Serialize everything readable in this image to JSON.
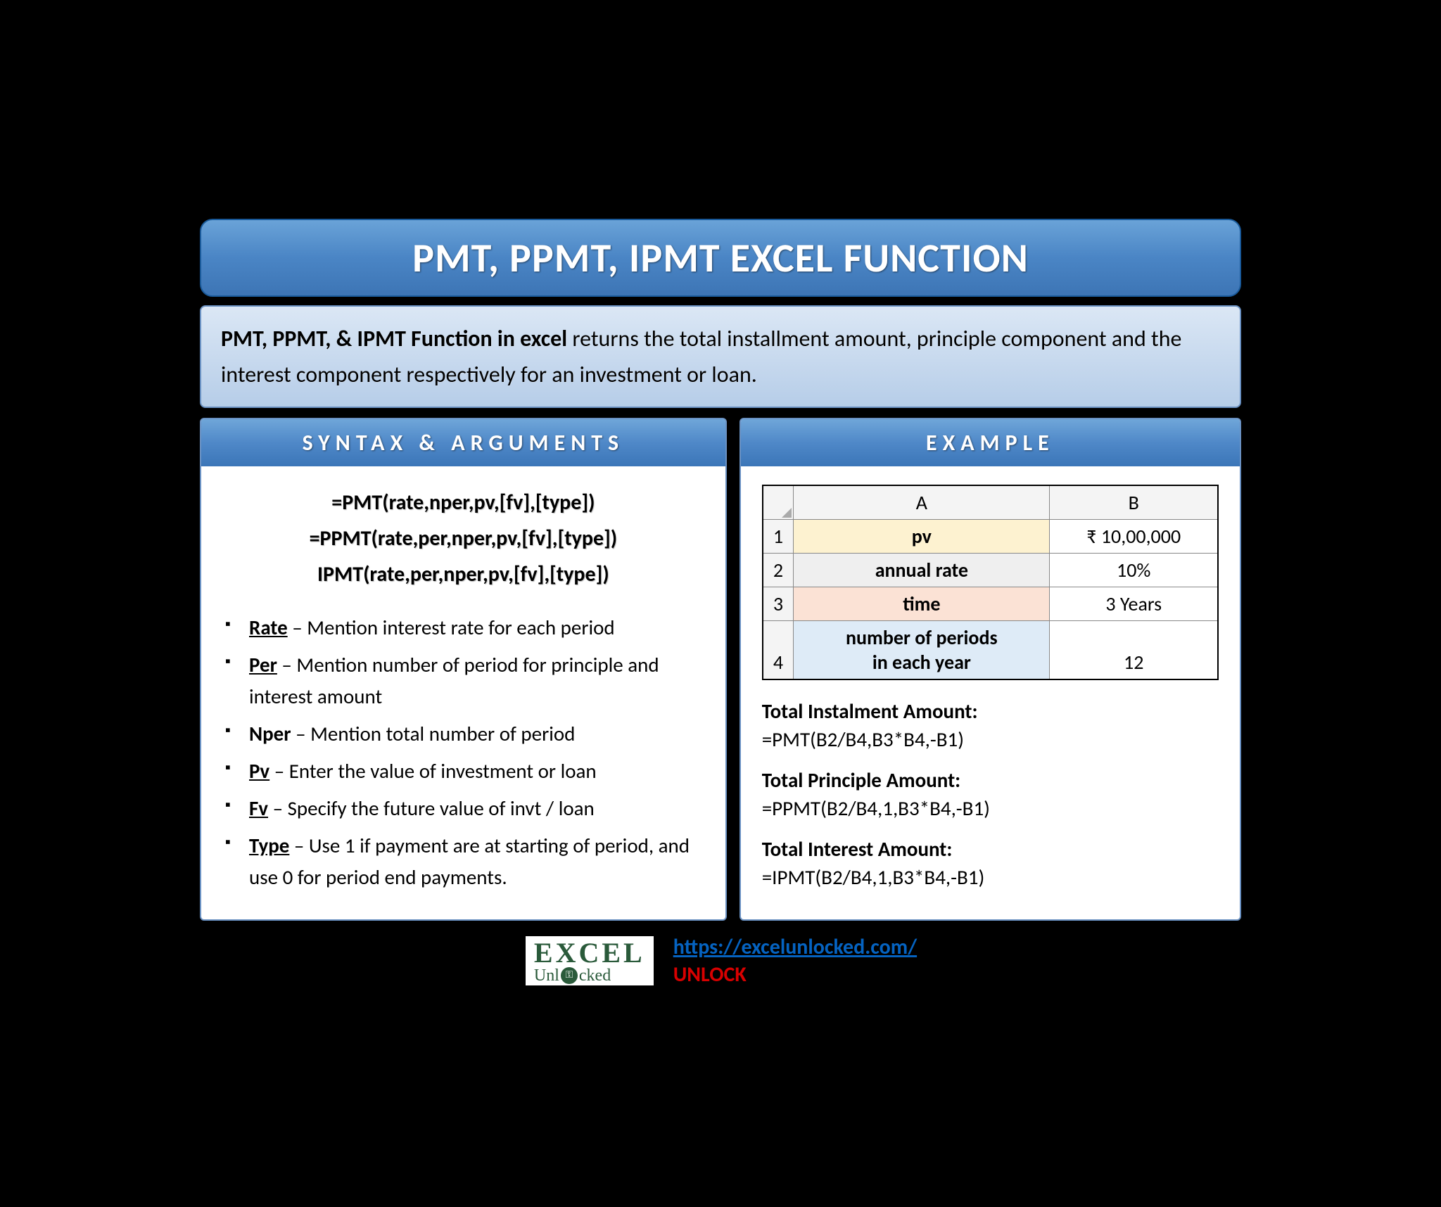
{
  "title": "PMT, PPMT, IPMT EXCEL FUNCTION",
  "description": {
    "bold": "PMT, PPMT, & IPMT Function in excel",
    "rest": " returns the total installment amount, principle component and the interest component respectively for an investment or loan."
  },
  "syntax": {
    "header": "SYNTAX & ARGUMENTS",
    "lines": [
      "=PMT(rate,nper,pv,[fv],[type])",
      "=PPMT(rate,per,nper,pv,[fv],[type])",
      "IPMT(rate,per,nper,pv,[fv],[type])"
    ],
    "args": [
      {
        "term": "Rate",
        "underline": true,
        "desc": " – Mention interest rate for each period"
      },
      {
        "term": "Per",
        "underline": true,
        "desc": " – Mention number of period for principle and interest amount"
      },
      {
        "term": "Nper",
        "underline": false,
        "desc": " – Mention total number of period"
      },
      {
        "term": "Pv",
        "underline": true,
        "desc": " – Enter the value of investment or loan"
      },
      {
        "term": "Fv",
        "underline": true,
        "desc": " – Specify the future value of invt / loan"
      },
      {
        "term": "Type",
        "underline": true,
        "desc": " – Use 1 if payment are at starting of period, and use 0 for period end payments."
      }
    ]
  },
  "example": {
    "header": "EXAMPLE",
    "grid": {
      "colA": "A",
      "colB": "B",
      "rows": [
        {
          "n": "1",
          "a": "pv",
          "b": "₹ 10,00,000",
          "cls": "cell-pv"
        },
        {
          "n": "2",
          "a": "annual rate",
          "b": "10%",
          "cls": "cell-rate"
        },
        {
          "n": "3",
          "a": "time",
          "b": "3 Years",
          "cls": "cell-time"
        },
        {
          "n": "4",
          "a": "number of periods\nin each year",
          "b": "12",
          "cls": "cell-nper"
        }
      ]
    },
    "formulas": [
      {
        "label": "Total Instalment Amount:",
        "formula": "=PMT(B2/B4,B3*B4,-B1)"
      },
      {
        "label": "Total Principle Amount:",
        "formula": "=PPMT(B2/B4,1,B3*B4,-B1)"
      },
      {
        "label": "Total Interest Amount:",
        "formula": "=IPMT(B2/B4,1,B3*B4,-B1)"
      }
    ]
  },
  "footer": {
    "logo_top": "EXCEL",
    "logo_bot_pre": "Unl",
    "logo_bot_post": "cked",
    "url": "https://excelunlocked.com/",
    "unlock": "UNLOCK"
  }
}
